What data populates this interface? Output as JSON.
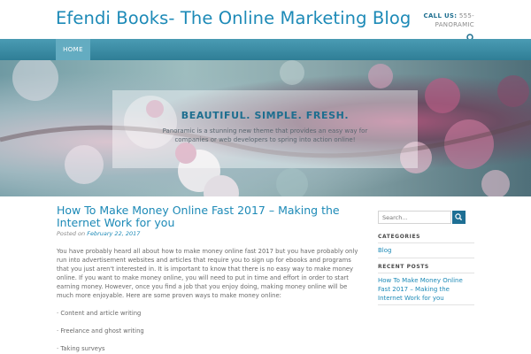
{
  "header": {
    "site_title": "Efendi Books- The Online Marketing Blog",
    "contact_label": "CALL US:",
    "contact_value": "555-",
    "contact_value2": "PANORAMIC",
    "search_icon": "search-icon"
  },
  "nav": {
    "items": [
      {
        "label": "HOME",
        "active": true
      }
    ]
  },
  "hero": {
    "title": "BEAUTIFUL. SIMPLE. FRESH.",
    "text": "Panoramic is a stunning new theme that provides an easy way for companies or web developers to spring into action online!"
  },
  "post": {
    "title": "How To Make Money Online Fast 2017 – Making the Internet Work for you",
    "posted_on": "Posted on",
    "date": "February 22, 2017",
    "intro": "You have probably heard all about how to make money online fast 2017 but you have probably only run into advertisement websites and articles that require you to sign up for ebooks and programs that you just aren't interested in. It is important to know that there is no easy way to make money online. If you want to make money online, you will need to put in time and effort in order to start earning money. However, once you find a job that you enjoy doing, making money online will be much more enjoyable. Here are some proven ways to make money online:",
    "list": [
      "· Content and article writing",
      "· Freelance and ghost writing",
      "· Taking surveys"
    ]
  },
  "sidebar": {
    "search_placeholder": "Search...",
    "categories_heading": "CATEGORIES",
    "categories": [
      "Blog"
    ],
    "recent_heading": "RECENT POSTS",
    "recent_posts": [
      "How To Make Money Online Fast 2017 – Making the Internet Work for you"
    ]
  },
  "colors": {
    "accent": "#1d8ab7",
    "nav": "#3d8fa6",
    "nav_active": "#64acc1",
    "search_button": "#1e6f94"
  }
}
